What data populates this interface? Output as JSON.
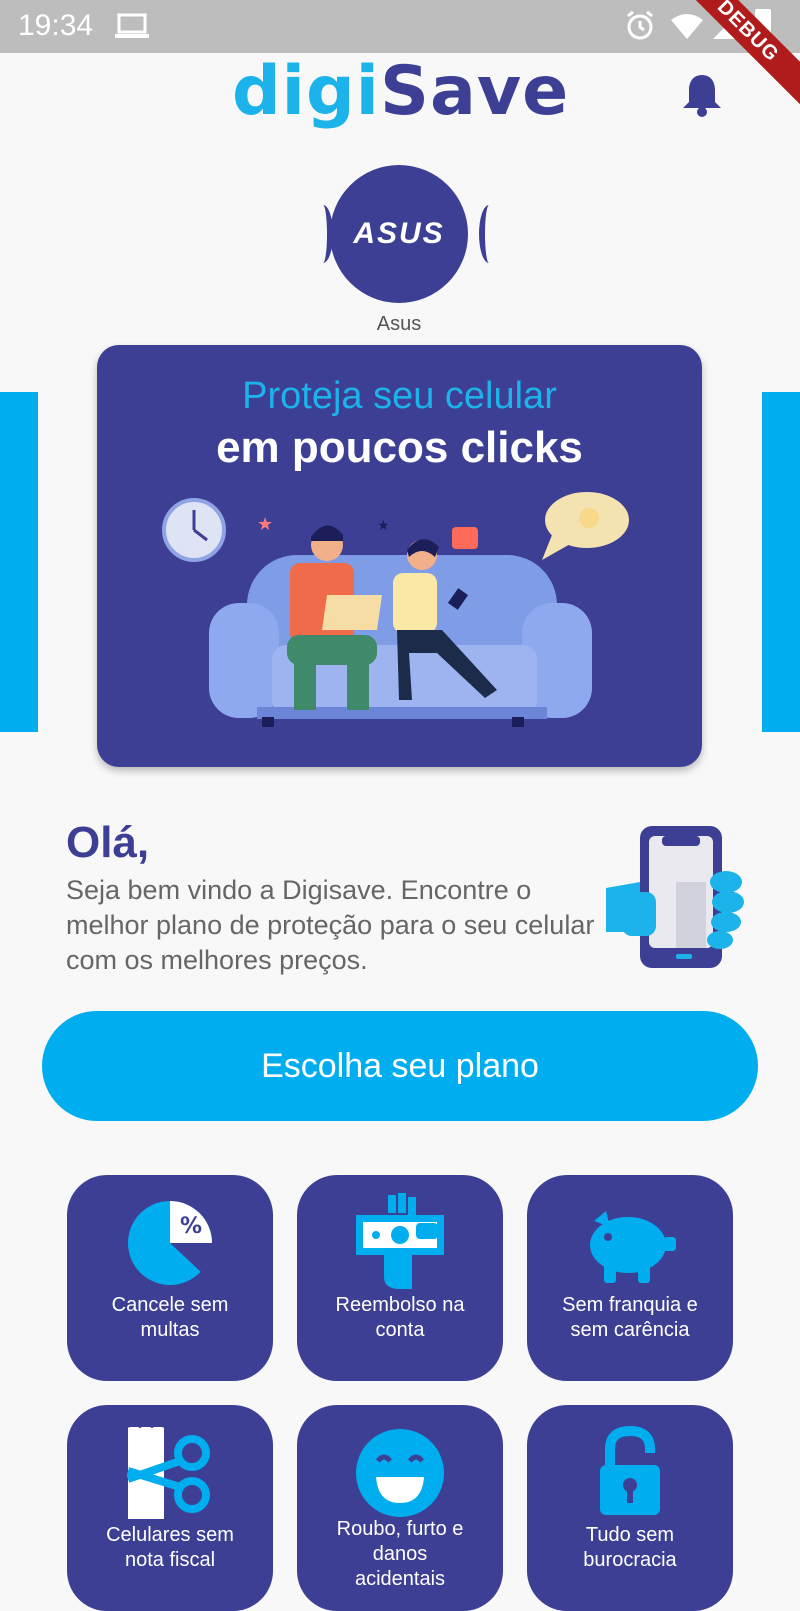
{
  "status_bar": {
    "time": "19:34",
    "debug_label": "DEBUG"
  },
  "header": {
    "logo_part1": "digi",
    "logo_part2": "Save",
    "bell_icon": "bell-icon"
  },
  "brand_selector": {
    "selected_brand": "Asus",
    "logo_text": "ASUS"
  },
  "banner": {
    "line1": "Proteja seu celular",
    "line2": "em poucos clicks"
  },
  "welcome": {
    "greeting": "Olá,",
    "message": "Seja bem vindo a Digisave. Encontre o melhor plano de proteção para o seu celular com os melhores preços."
  },
  "cta": {
    "label": "Escolha seu plano"
  },
  "features": [
    {
      "label_line1": "Cancele sem",
      "label_line2": "multas",
      "icon": "pie-chart-percent-icon"
    },
    {
      "label_line1": "Reembolso na",
      "label_line2": "conta",
      "icon": "money-hand-icon"
    },
    {
      "label_line1": "Sem franquia e",
      "label_line2": "sem carência",
      "icon": "piggy-bank-icon"
    },
    {
      "label_line1": "Celulares sem",
      "label_line2": "nota fiscal",
      "icon": "scissors-receipt-icon"
    },
    {
      "label_line1": "Roubo, furto e",
      "label_line2": "danos",
      "label_line3": "acidentais",
      "icon": "smiley-icon"
    },
    {
      "label_line1": "Tudo sem",
      "label_line2": "burocracia",
      "icon": "unlocked-padlock-icon"
    }
  ],
  "colors": {
    "primary": "#3d3f94",
    "accent": "#00aeef",
    "light_accent": "#1cb3ea"
  }
}
